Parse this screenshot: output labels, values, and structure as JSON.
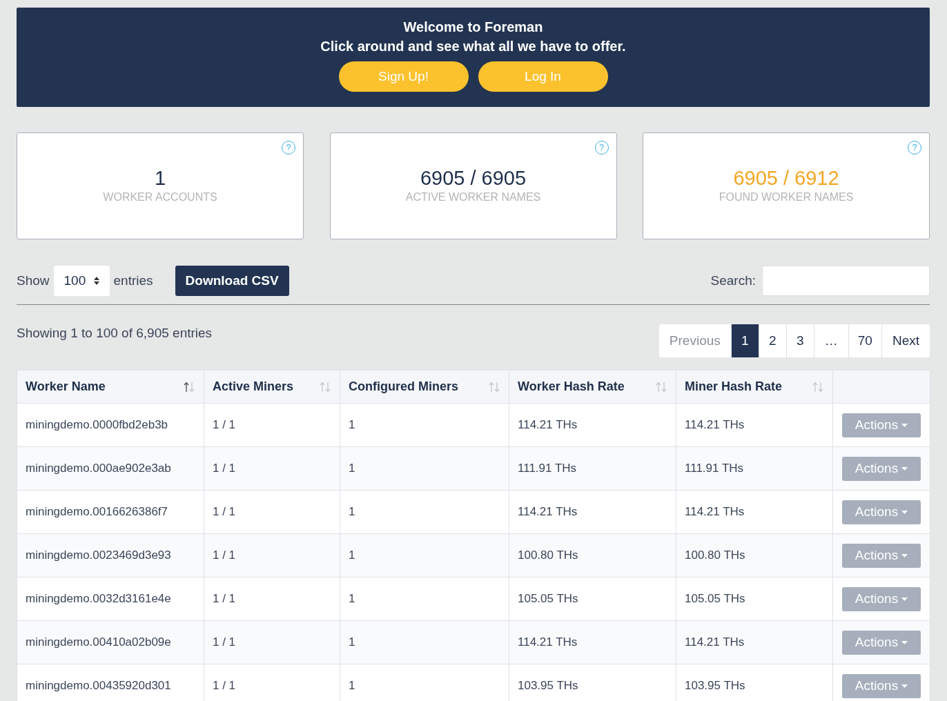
{
  "banner": {
    "title": "Welcome to Foreman",
    "subtitle": "Click around and see what all we have to offer.",
    "buttons": [
      "Sign Up!",
      "Log In"
    ]
  },
  "stats": [
    {
      "value": "1",
      "label": "WORKER ACCOUNTS",
      "color": "#1e2e4a",
      "help": "?"
    },
    {
      "value": "6905 / 6905",
      "label": "ACTIVE WORKER NAMES",
      "color": "#1e2e4a",
      "help": "?"
    },
    {
      "value": "6905 / 6912",
      "label": "FOUND WORKER NAMES",
      "color": "#f5a623",
      "help": "?"
    }
  ],
  "controls": {
    "show_label": "Show",
    "page_size": "100",
    "entries_label": "entries",
    "download_button": "Download CSV",
    "search_label": "Search:"
  },
  "info": "Showing 1 to 100 of 6,905 entries",
  "pagination": [
    {
      "label": "Previous",
      "kind": "nav",
      "disabled": true,
      "selected": false
    },
    {
      "label": "1",
      "kind": "page",
      "disabled": false,
      "selected": true
    },
    {
      "label": "2",
      "kind": "page",
      "disabled": false,
      "selected": false
    },
    {
      "label": "3",
      "kind": "page",
      "disabled": false,
      "selected": false
    },
    {
      "label": "…",
      "kind": "gap",
      "disabled": false,
      "selected": false
    },
    {
      "label": "70",
      "kind": "page",
      "disabled": false,
      "selected": false
    },
    {
      "label": "Next",
      "kind": "nav",
      "disabled": false,
      "selected": false
    }
  ],
  "table": {
    "columns": [
      {
        "label": "Worker Name",
        "sorted": true
      },
      {
        "label": "Active Miners",
        "sorted": false
      },
      {
        "label": "Configured Miners",
        "sorted": false
      },
      {
        "label": "Worker Hash Rate",
        "sorted": false
      },
      {
        "label": "Miner Hash Rate",
        "sorted": false
      }
    ],
    "rows": [
      {
        "cells": [
          "miningdemo.0000fbd2eb3b",
          "1 / 1",
          "1",
          "114.21 THs",
          "114.21 THs"
        ],
        "action": "Actions"
      },
      {
        "cells": [
          "miningdemo.000ae902e3ab",
          "1 / 1",
          "1",
          "111.91 THs",
          "111.91 THs"
        ],
        "action": "Actions"
      },
      {
        "cells": [
          "miningdemo.0016626386f7",
          "1 / 1",
          "1",
          "114.21 THs",
          "114.21 THs"
        ],
        "action": "Actions"
      },
      {
        "cells": [
          "miningdemo.0023469d3e93",
          "1 / 1",
          "1",
          "100.80 THs",
          "100.80 THs"
        ],
        "action": "Actions"
      },
      {
        "cells": [
          "miningdemo.0032d3161e4e",
          "1 / 1",
          "1",
          "105.05 THs",
          "105.05 THs"
        ],
        "action": "Actions"
      },
      {
        "cells": [
          "miningdemo.00410a02b09e",
          "1 / 1",
          "1",
          "114.21 THs",
          "114.21 THs"
        ],
        "action": "Actions"
      },
      {
        "cells": [
          "miningdemo.00435920d301",
          "1 / 1",
          "1",
          "103.95 THs",
          "103.95 THs"
        ],
        "action": "Actions"
      }
    ]
  }
}
